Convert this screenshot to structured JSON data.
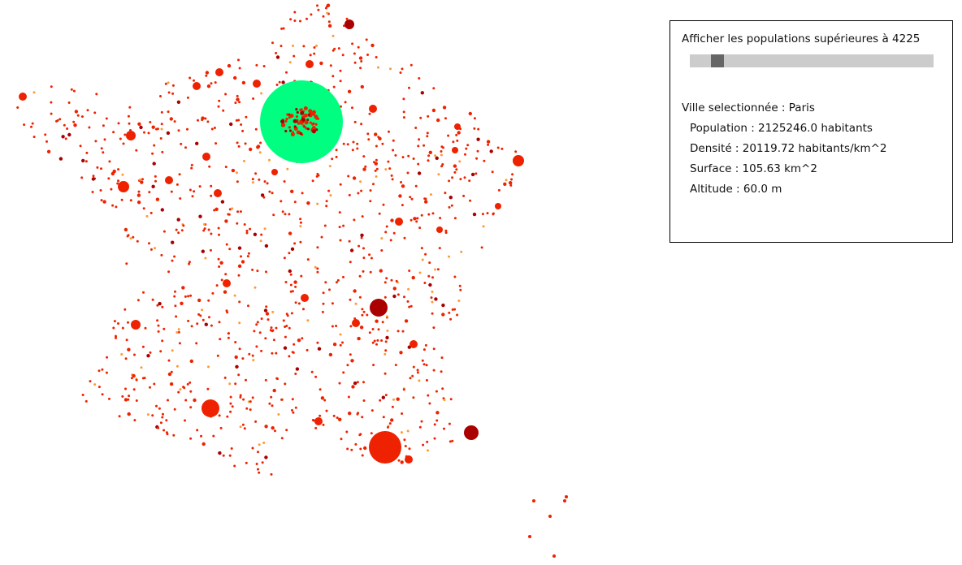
{
  "filter": {
    "label": "Afficher les populations supérieures à 4225",
    "slider_fraction": 0.05
  },
  "selected": {
    "title": "Ville selectionnée : Paris",
    "population": "Population : 2125246.0 habitants",
    "density": "Densité : 20119.72 habitants/km^2",
    "surface": "Surface : 105.63 km^2",
    "altitude": "Altitude : 60.0 m"
  },
  "colors": {
    "highlight": "#00ff80",
    "city": "#ee2200",
    "city_dense": "#aa0000",
    "city_small": "#ff9933"
  }
}
